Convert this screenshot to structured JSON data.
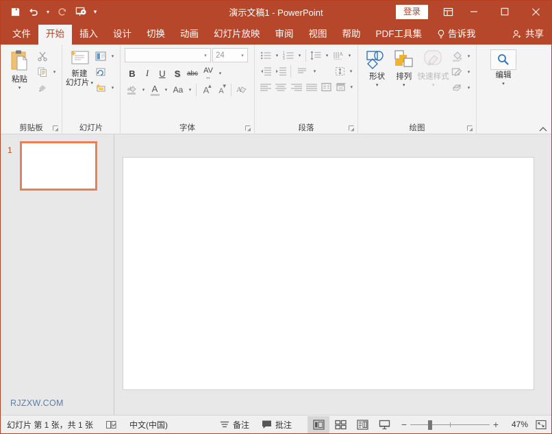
{
  "window": {
    "title": "演示文稿1  -  PowerPoint",
    "sign_in": "登录",
    "ribbon_display_icon": "ribbon-display-options-icon",
    "minimize": "—",
    "maximize": "▢",
    "close": "✕"
  },
  "quick_access": {
    "save": "save-icon",
    "undo": "undo-icon",
    "undo_caret": "▾",
    "redo": "redo-icon",
    "slideshow": "start-slideshow-icon",
    "customize": "▾"
  },
  "tabs": [
    {
      "label": "文件",
      "active": false
    },
    {
      "label": "开始",
      "active": true
    },
    {
      "label": "插入",
      "active": false
    },
    {
      "label": "设计",
      "active": false
    },
    {
      "label": "切换",
      "active": false
    },
    {
      "label": "动画",
      "active": false
    },
    {
      "label": "幻灯片放映",
      "active": false
    },
    {
      "label": "审阅",
      "active": false
    },
    {
      "label": "视图",
      "active": false
    },
    {
      "label": "帮助",
      "active": false
    },
    {
      "label": "PDF工具集",
      "active": false
    }
  ],
  "tell_me": {
    "label": "告诉我",
    "icon": "lightbulb-icon"
  },
  "share": {
    "label": "共享",
    "icon": "person-add-icon"
  },
  "ribbon": {
    "clipboard": {
      "label": "剪贴板",
      "paste": {
        "label": "粘贴",
        "caret": "▾",
        "icon": "paste-clipboard-icon"
      },
      "cut": "cut-scissors-icon",
      "copy": "copy-icon",
      "copy_caret": "▾",
      "format_painter": "format-painter-icon"
    },
    "slides": {
      "label": "幻灯片",
      "new_slide": {
        "label": "新建\n幻灯片",
        "line1": "新建",
        "line2": "幻灯片",
        "caret": "▾",
        "icon": "new-slide-icon"
      },
      "layout": {
        "icon": "slide-layout-icon",
        "caret": "▾"
      },
      "reset": {
        "icon": "reset-slide-icon"
      },
      "section": {
        "icon": "section-icon",
        "caret": "▾"
      }
    },
    "font": {
      "label": "字体",
      "font_name_value": "",
      "font_name_placeholder": "",
      "font_size_value": "24",
      "bold": "B",
      "italic": "I",
      "underline": "U",
      "shadow": "S",
      "strikethrough": "abc",
      "char_spacing": "AV",
      "char_spacing_caret": "▾",
      "text_highlight": "text-highlight-icon",
      "text_highlight_caret": "▾",
      "font_color": "A",
      "font_color_caret": "▾",
      "change_case": "Aa",
      "change_case_caret": "▾",
      "increase_size": "A",
      "decrease_size": "A",
      "clear_formatting": "clear-formatting-icon"
    },
    "paragraph": {
      "label": "段落",
      "bullets": {
        "icon": "bullet-list-icon",
        "caret": "▾"
      },
      "numbering": {
        "icon": "numbered-list-icon",
        "caret": "▾"
      },
      "line_spacing": {
        "icon": "line-spacing-icon",
        "caret": "▾"
      },
      "text_direction": {
        "icon": "text-direction-icon",
        "caret": "▾"
      },
      "decrease_indent": {
        "icon": "decrease-indent-icon"
      },
      "increase_indent": {
        "icon": "increase-indent-icon"
      },
      "paragraph_spacing": {
        "icon": "paragraph-spacing-icon",
        "caret": "▾"
      },
      "align_text": {
        "icon": "align-text-vertical-icon",
        "caret": "▾"
      },
      "align_left": {
        "icon": "align-left-icon"
      },
      "align_center": {
        "icon": "align-center-icon"
      },
      "align_right": {
        "icon": "align-right-icon"
      },
      "justify": {
        "icon": "justify-icon"
      },
      "columns": {
        "icon": "columns-icon"
      },
      "smartart": {
        "icon": "convert-to-smartart-icon",
        "caret": "▾"
      }
    },
    "drawing": {
      "label": "绘图",
      "shapes": {
        "label": "形状",
        "caret": "▾",
        "icon": "shapes-icon"
      },
      "arrange": {
        "label": "排列",
        "caret": "▾",
        "icon": "arrange-icon"
      },
      "quick_styles": {
        "label": "快速样式",
        "caret": "▾",
        "icon": "quick-styles-icon",
        "disabled": true
      },
      "shape_fill": {
        "icon": "shape-fill-icon",
        "caret": "▾"
      },
      "shape_outline": {
        "icon": "shape-outline-icon",
        "caret": "▾"
      },
      "shape_effects": {
        "icon": "shape-effects-icon",
        "caret": "▾"
      }
    },
    "editing": {
      "label": "编辑",
      "find": {
        "label": "编辑",
        "caret": "▾",
        "icon": "search-magnifier-icon"
      }
    },
    "collapse": "⌃"
  },
  "thumbnails": {
    "slides": [
      {
        "number": "1",
        "selected": true
      }
    ],
    "watermark": "RJZXW.COM"
  },
  "status_bar": {
    "slide_count": "幻灯片 第 1 张，共 1 张",
    "spell_check_icon": "spell-check-icon",
    "language": "中文(中国)",
    "notes": {
      "label": "备注",
      "icon": "notes-icon"
    },
    "comments": {
      "label": "批注",
      "icon": "comment-icon"
    },
    "views": [
      {
        "name": "normal-view",
        "icon": "normal-view-icon",
        "active": true
      },
      {
        "name": "slide-sorter-view",
        "icon": "slide-sorter-icon",
        "active": false
      },
      {
        "name": "reading-view",
        "icon": "reading-view-icon",
        "active": false
      },
      {
        "name": "slideshow-view",
        "icon": "slideshow-view-icon",
        "active": false
      }
    ],
    "zoom_out": "−",
    "zoom_in": "+",
    "zoom_level": "47%",
    "fit_to_window": "fit-slide-icon"
  },
  "colors": {
    "accent": "#b7472a",
    "thumb_border": "#ed7d52",
    "ribbon_bg": "#f4f4f4",
    "workspace_bg": "#e8e8e8",
    "watermark": "#5b7fa6"
  }
}
